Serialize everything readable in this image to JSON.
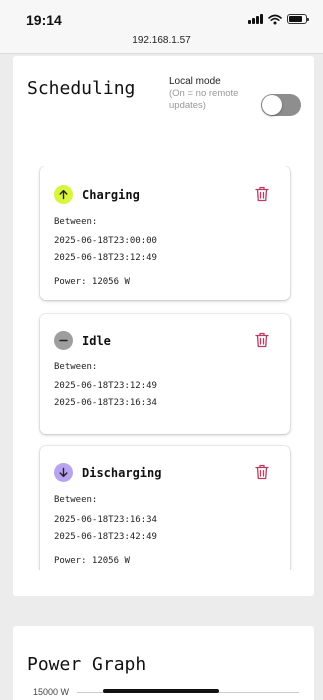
{
  "status_bar": {
    "time": "19:14"
  },
  "browser": {
    "url": "192.168.1.57"
  },
  "scheduling": {
    "title": "Scheduling",
    "local_mode": {
      "label": "Local mode",
      "note": "(On = no remote updates)",
      "enabled": false
    },
    "entries": [
      {
        "state": "Charging",
        "icon": "arrow-up-icon",
        "icon_color": "#d9f53c",
        "between_label": "Between:",
        "start": "2025-06-18T23:00:00",
        "end": "2025-06-18T23:12:49",
        "power": "Power: 12056 W"
      },
      {
        "state": "Idle",
        "icon": "minus-icon",
        "icon_color": "#9e9e9e",
        "between_label": "Between:",
        "start": "2025-06-18T23:12:49",
        "end": "2025-06-18T23:16:34"
      },
      {
        "state": "Discharging",
        "icon": "arrow-down-icon",
        "icon_color": "#b9a3f0",
        "between_label": "Between:",
        "start": "2025-06-18T23:16:34",
        "end": "2025-06-18T23:42:49",
        "power": "Power: 12056 W"
      }
    ]
  },
  "power_graph": {
    "title": "Power Graph",
    "y_tick": "15000 W"
  },
  "colors": {
    "delete": "#c0395f",
    "toggle_off": "#8e8e8e"
  }
}
